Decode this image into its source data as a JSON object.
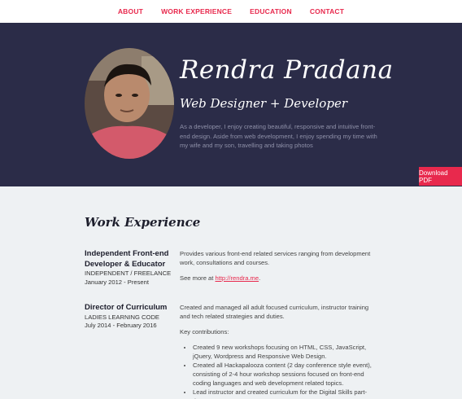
{
  "nav": {
    "items": [
      "ABOUT",
      "WORK EXPERIENCE",
      "EDUCATION",
      "CONTACT"
    ]
  },
  "hero": {
    "name": "Rendra Pradana",
    "role": "Web Designer + Developer",
    "bio": "As a developer, I enjoy creating beautiful, responsive and intuitive front-end design. Aside from web development, I enjoy spending my time with my wife and my son, travelling and taking photos",
    "download_label": "Download PDF"
  },
  "work": {
    "title": "Work Experience",
    "jobs": [
      {
        "title": "Independent Front-end Developer & Educator",
        "company": "INDEPENDENT / FREELANCE",
        "dates": "January 2012 - Present",
        "description": "Provides various front-end related services ranging from development work, consultations and courses.",
        "see_more_prefix": "See more at ",
        "link": "http://rendra.me",
        "see_more_suffix": "."
      },
      {
        "title": "Director of Curriculum",
        "company": "LADIES LEARNING CODE",
        "dates": "July 2014 - February 2016",
        "description": "Created and managed all adult focused curriculum, instructor training and tech related strategies and duties.",
        "contrib_label": "Key contributions:",
        "bullets": [
          "Created 9 new workshops focusing on HTML, CSS, JavaScript, jQuery, Wordpress and Responsive Web Design.",
          "Created all Hackapalooza content (2 day conference style event), consisting of 2-4 hour workshop sessions focused on front-end coding languages and web development related topics.",
          "Lead instructor and created curriculum for the Digital Skills part-time"
        ]
      }
    ]
  }
}
